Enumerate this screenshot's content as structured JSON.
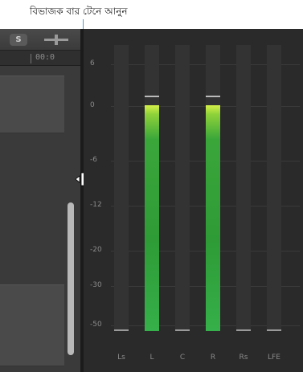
{
  "callout": {
    "text": "বিভাজক বার টেনে আনুন"
  },
  "toolbar": {
    "solo_label": "S"
  },
  "ruler": {
    "time": "00:0"
  },
  "meter": {
    "scale": [
      "6",
      "0",
      "-6",
      "-12",
      "-20",
      "-30",
      "-50"
    ],
    "channels": [
      {
        "name": "Ls",
        "level": 0.0
      },
      {
        "name": "L",
        "level": 0.79
      },
      {
        "name": "C",
        "level": 0.0
      },
      {
        "name": "R",
        "level": 0.79
      },
      {
        "name": "Rs",
        "level": 0.0
      },
      {
        "name": "LFE",
        "level": 0.0
      }
    ]
  },
  "colors": {
    "meter_green": "#2e9b36",
    "meter_peak_yellow": "#d6f04a",
    "callout_line": "#4a9ad8"
  },
  "icons": [
    "solo-icon",
    "snap-icon",
    "resize-cursor-icon"
  ]
}
